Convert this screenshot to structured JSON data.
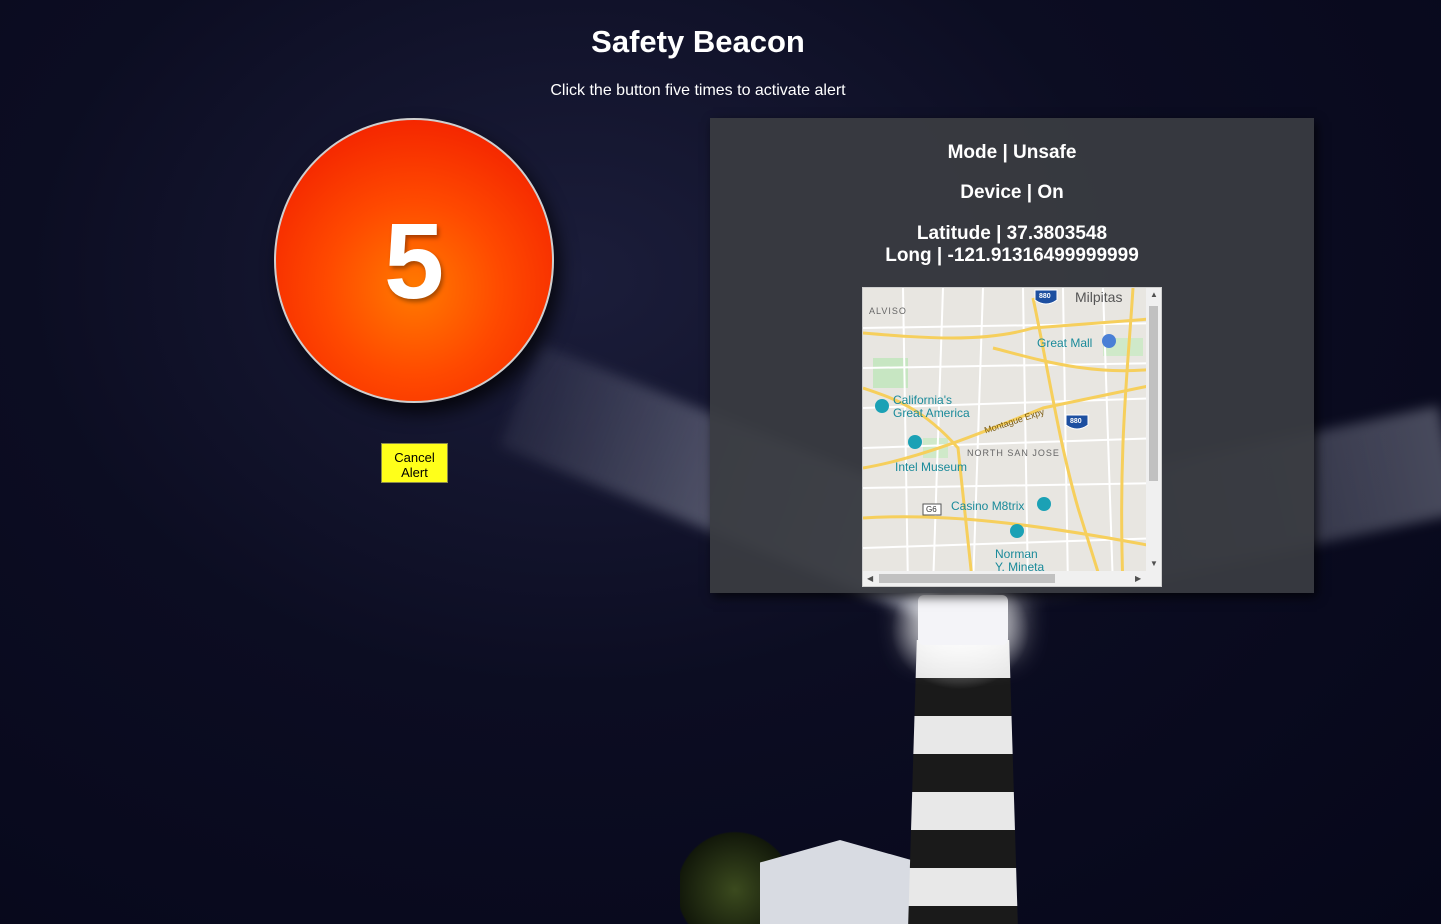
{
  "header": {
    "title": "Safety Beacon",
    "subtitle": "Click the button five times to activate alert"
  },
  "beacon": {
    "count": "5",
    "cancel_label": "Cancel Alert"
  },
  "status": {
    "mode": "Mode | Unsafe",
    "device": "Device | On",
    "latitude": "Latitude | 37.3803548",
    "longitude": "Long | -121.91316499999999"
  },
  "map": {
    "labels": {
      "milpitas": "Milpitas",
      "alviso": "ALVISO",
      "great_mall": "Great Mall",
      "californias": "California's",
      "great_america": "Great America",
      "montague": "Montague Expy",
      "north_san_jose": "NORTH SAN JOSE",
      "intel_museum": "Intel Museum",
      "casino": "Casino M8trix",
      "norman": "Norman",
      "mineta": "Y. Mineta",
      "i880_top": "880",
      "i880_mid": "880",
      "g6": "G6"
    }
  },
  "colors": {
    "alert_button": "#f42400",
    "cancel_button": "#ffff1a",
    "panel": "#3a3c42"
  }
}
